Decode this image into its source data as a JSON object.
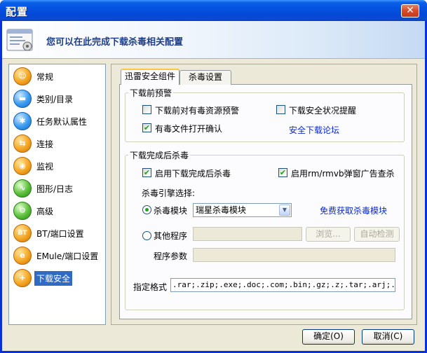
{
  "window": {
    "title": "配置",
    "close_label": "✕"
  },
  "banner": {
    "text": "您可以在此完成下载杀毒相关配置"
  },
  "sidebar": {
    "items": [
      {
        "label": "常规",
        "icon": "general-icon",
        "glyph": "☺"
      },
      {
        "label": "类别/目录",
        "icon": "folder-icon",
        "glyph": "▬"
      },
      {
        "label": "任务默认属性",
        "icon": "task-properties-icon",
        "glyph": "✱"
      },
      {
        "label": "连接",
        "icon": "connection-icon",
        "glyph": "⇆"
      },
      {
        "label": "监视",
        "icon": "monitor-icon",
        "glyph": "◉"
      },
      {
        "label": "图形/日志",
        "icon": "graph-log-icon",
        "glyph": "∿"
      },
      {
        "label": "高级",
        "icon": "advanced-icon",
        "glyph": "⚙"
      },
      {
        "label": "BT/端口设置",
        "icon": "bt-icon",
        "glyph": "BT"
      },
      {
        "label": "EMule/端口设置",
        "icon": "emule-icon",
        "glyph": "e"
      },
      {
        "label": "下载安全",
        "icon": "download-security-icon",
        "glyph": "+"
      }
    ],
    "selected": "下载安全"
  },
  "tabs": [
    {
      "label": "迅雷安全组件",
      "active": true
    },
    {
      "label": "杀毒设置",
      "active": false
    }
  ],
  "pre_download": {
    "title": "下载前预警",
    "options": [
      {
        "label": "下载前对有毒资源预警",
        "checked": false
      },
      {
        "label": "下载安全状况提醒",
        "checked": false
      },
      {
        "label": "有毒文件打开确认",
        "checked": true
      }
    ],
    "forum_link": "安全下载论坛"
  },
  "post_download": {
    "title": "下载完成后杀毒",
    "options": [
      {
        "label": "启用下载完成后杀毒",
        "checked": true
      },
      {
        "label": "启用rm/rmvb弹窗广告查杀",
        "checked": true
      }
    ],
    "engine_label": "杀毒引擎选择:",
    "module_radio": "杀毒模块",
    "module_selected": "瑞星杀毒模块",
    "free_link": "免费获取杀毒模块",
    "other_radio": "其他程序",
    "other_program_value": "",
    "browse_label": "浏览...",
    "autodetect_label": "自动检测",
    "params_label": "程序参数",
    "params_value": "",
    "formats_label": "指定格式",
    "formats_value": ".rar;.zip;.exe;.doc;.com;.bin;.gz;.z;.tar;.arj;.lzh;."
  },
  "footer": {
    "ok_label": "确定(O)",
    "cancel_label": "取消(C)"
  }
}
